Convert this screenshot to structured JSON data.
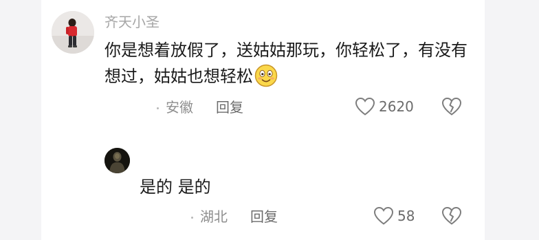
{
  "comment": {
    "username": "齐天小圣",
    "text": "你是想着放假了，送姑姑那玩，你轻松了，有没有想过，姑姑也想轻松",
    "location": "安徽",
    "reply_label": "回复",
    "like_count": "2620"
  },
  "reply": {
    "text": "是的 是的",
    "location": "湖北",
    "reply_label": "回复",
    "like_count": "58"
  },
  "icons": {
    "emoji": "smiling-face-icon",
    "like": "heart-outline-icon",
    "dislike": "broken-heart-icon"
  }
}
